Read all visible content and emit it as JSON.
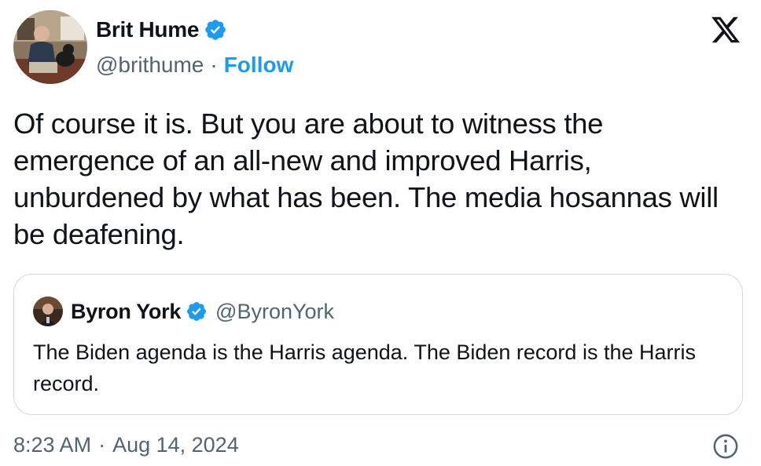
{
  "author": {
    "name": "Brit Hume",
    "handle": "@brithume",
    "follow_label": "Follow",
    "separator": "·",
    "verified_icon": "verified-badge-icon",
    "avatar": "profile-photo"
  },
  "platform": {
    "logo": "x-logo-icon"
  },
  "tweet": {
    "text": "Of course it is. But you are about to witness the emergence of an all-new and improved Harris, unburdened by what has been. The media hosannas will be deafening."
  },
  "quote": {
    "name": "Byron York",
    "handle": "@ByronYork",
    "text": "The Biden agenda is the Harris agenda. The Biden record is the Harris record.",
    "verified_icon": "verified-badge-icon"
  },
  "footer": {
    "time": "8:23 AM",
    "separator": "·",
    "date": "Aug 14, 2024",
    "info_icon": "info-icon"
  },
  "colors": {
    "accent": "#1d9bf0",
    "text": "#0f1419",
    "secondary": "#536471",
    "border": "#cfd9de"
  }
}
